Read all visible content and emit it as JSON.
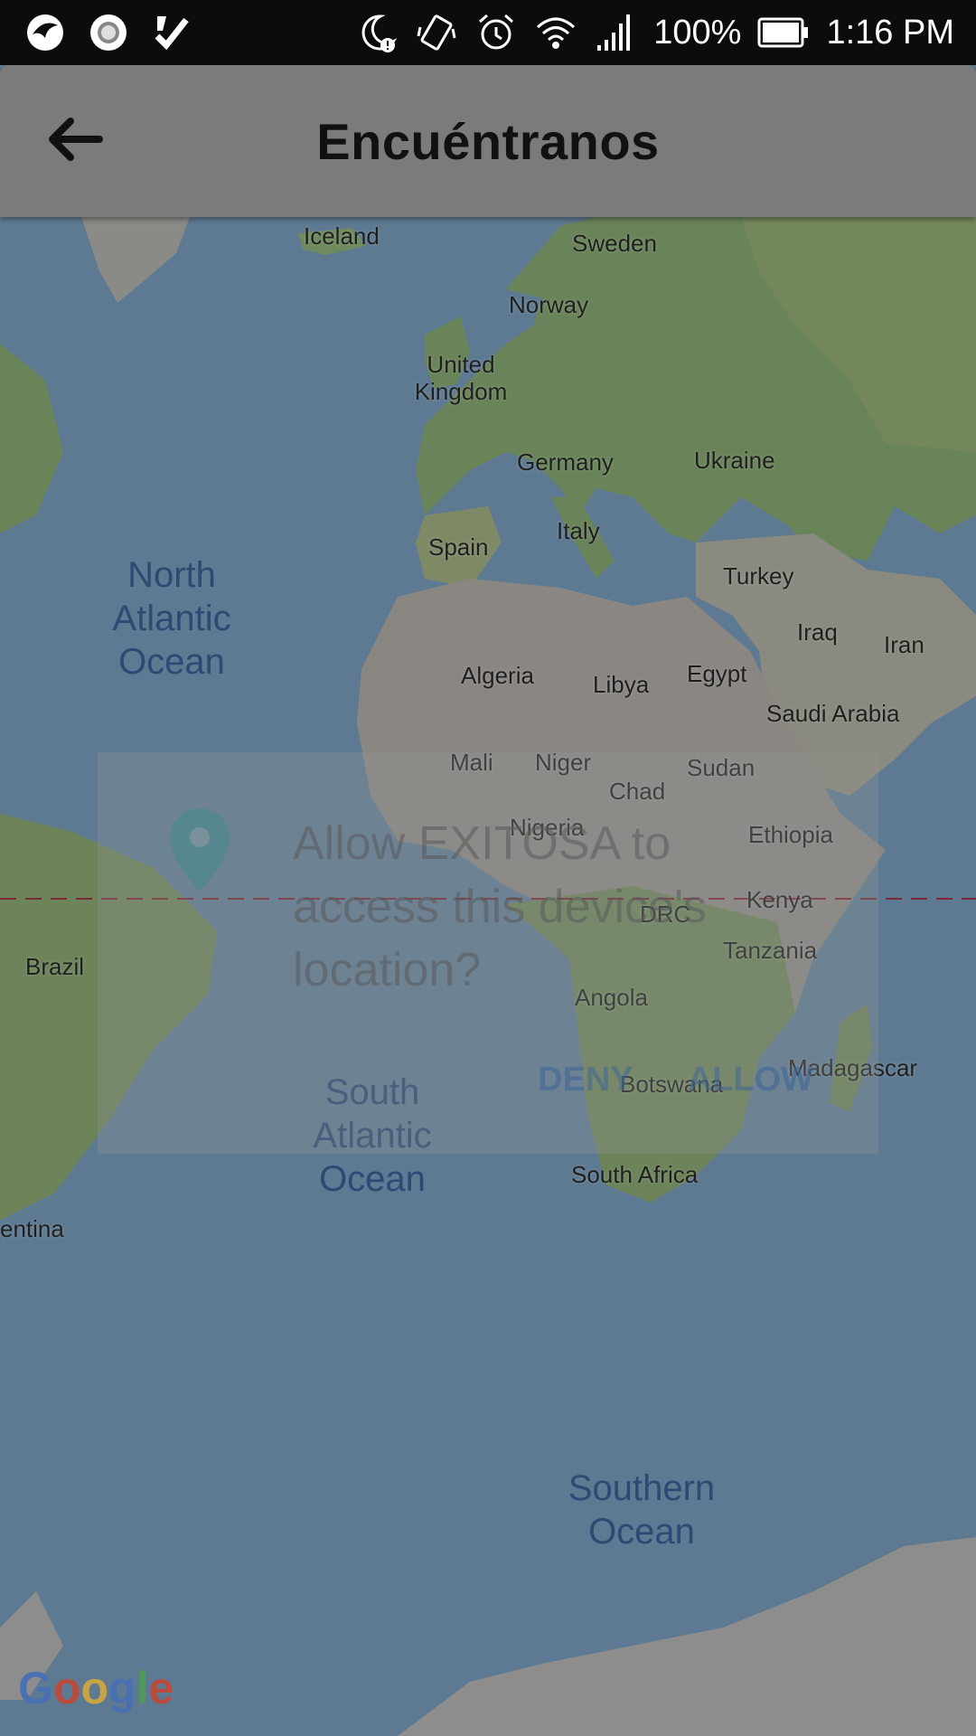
{
  "status_bar": {
    "battery": "100%",
    "time": "1:16 PM"
  },
  "app_bar": {
    "title": "Encuéntranos"
  },
  "map": {
    "countries": [
      {
        "label": "Iceland"
      },
      {
        "label": "Sweden"
      },
      {
        "label": "Norway"
      },
      {
        "label": "United Kingdom"
      },
      {
        "label": "Germany"
      },
      {
        "label": "Ukraine"
      },
      {
        "label": "Spain"
      },
      {
        "label": "Italy"
      },
      {
        "label": "Turkey"
      },
      {
        "label": "Iraq"
      },
      {
        "label": "Iran"
      },
      {
        "label": "Algeria"
      },
      {
        "label": "Libya"
      },
      {
        "label": "Egypt"
      },
      {
        "label": "Saudi Arabia"
      },
      {
        "label": "Mali"
      },
      {
        "label": "Niger"
      },
      {
        "label": "Sudan"
      },
      {
        "label": "Chad"
      },
      {
        "label": "Nigeria"
      },
      {
        "label": "Ethiopia"
      },
      {
        "label": "Kenya"
      },
      {
        "label": "DRC"
      },
      {
        "label": "Tanzania"
      },
      {
        "label": "Brazil"
      },
      {
        "label": "Angola"
      },
      {
        "label": "Madagascar"
      },
      {
        "label": "Botswana"
      },
      {
        "label": "South Africa"
      },
      {
        "label": "entina"
      }
    ],
    "oceans": [
      {
        "label": "North Atlantic Ocean"
      },
      {
        "label": "South Atlantic Ocean"
      },
      {
        "label": "Southern Ocean"
      }
    ]
  },
  "dialog": {
    "message": "Allow EXITOSA to access this device's location?",
    "deny_label": "DENY",
    "allow_label": "ALLOW"
  },
  "attribution": {
    "logo": "Google"
  }
}
